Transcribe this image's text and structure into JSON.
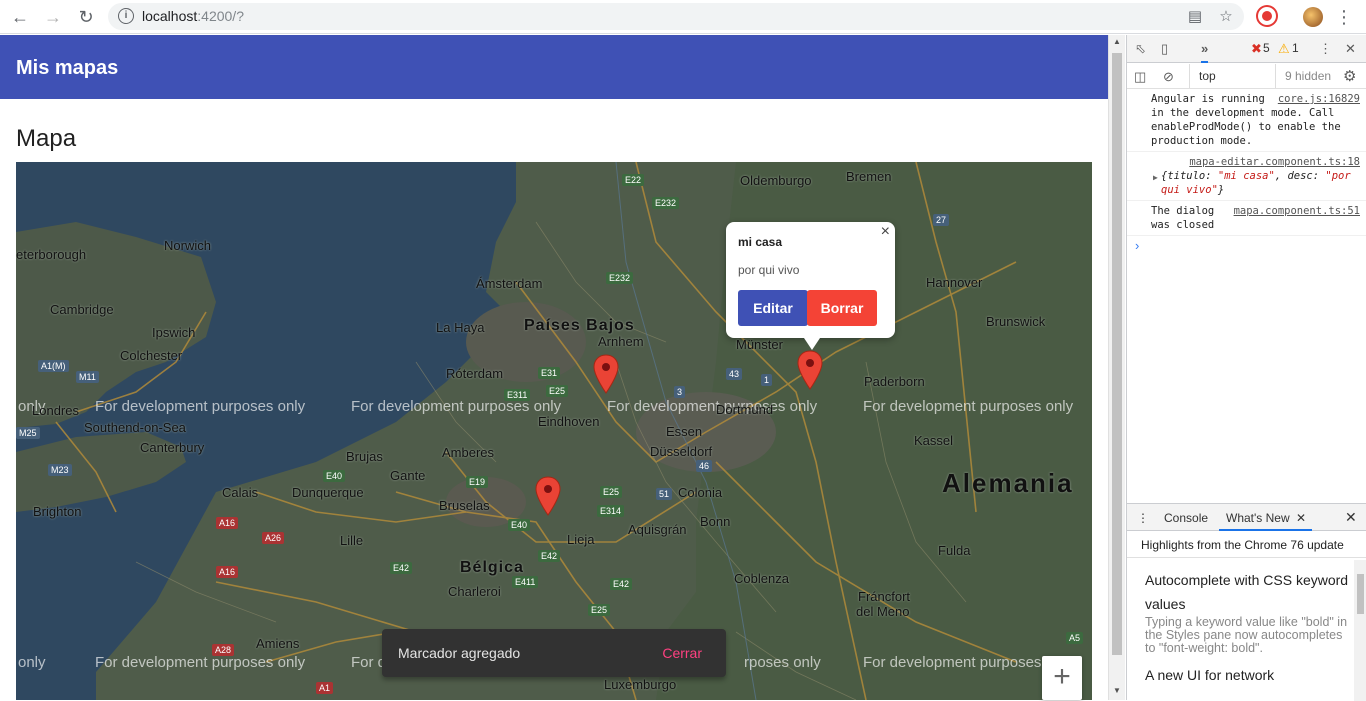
{
  "browser": {
    "url_host": "localhost",
    "url_rest": ":4200/?"
  },
  "app": {
    "toolbar_title": "Mis mapas",
    "page_heading": "Mapa"
  },
  "map": {
    "cities": [
      {
        "name": "Oldemburgo"
      },
      {
        "name": "Bremen"
      },
      {
        "name": "Norwich"
      },
      {
        "name": "eterborough"
      },
      {
        "name": "Ámsterdam"
      },
      {
        "name": "Hannover"
      },
      {
        "name": "Cambridge"
      },
      {
        "name": "Ipswich"
      },
      {
        "name": "La Haya"
      },
      {
        "name": "Arnhem"
      },
      {
        "name": "Brunswick"
      },
      {
        "name": "Colchester"
      },
      {
        "name": "Münster"
      },
      {
        "name": "Róterdam"
      },
      {
        "name": "Paderborn"
      },
      {
        "name": "Londres"
      },
      {
        "name": "Eindhoven"
      },
      {
        "name": "Southend-on-Sea"
      },
      {
        "name": "Essen"
      },
      {
        "name": "Dortmund"
      },
      {
        "name": "Kassel"
      },
      {
        "name": "Canterbury"
      },
      {
        "name": "Brujas"
      },
      {
        "name": "Amberes"
      },
      {
        "name": "Düsseldorf"
      },
      {
        "name": "Gante"
      },
      {
        "name": "Calais"
      },
      {
        "name": "Dunquerque"
      },
      {
        "name": "Colonia"
      },
      {
        "name": "Bruselas"
      },
      {
        "name": "Brighton"
      },
      {
        "name": "Aquisgrán"
      },
      {
        "name": "Bonn"
      },
      {
        "name": "Lille"
      },
      {
        "name": "Lieja"
      },
      {
        "name": "Fulda"
      },
      {
        "name": "Charleroi"
      },
      {
        "name": "Coblenza"
      },
      {
        "name": "Fráncfort"
      },
      {
        "name": "del Meno"
      },
      {
        "name": "Amiens"
      },
      {
        "name": "Luxemburgo"
      }
    ],
    "countries": [
      {
        "name": "Países Bajos"
      },
      {
        "name": "Alemania"
      },
      {
        "name": "Bélgica"
      }
    ],
    "watermark": "For development purposes only",
    "watermark_fragment_only": "only",
    "watermark_fragment_for": "For d",
    "watermark_fragment_end": "rposes only",
    "info_window": {
      "title": "mi casa",
      "description": "por qui vivo",
      "edit_label": "Editar",
      "delete_label": "Borrar",
      "close_glyph": "×"
    },
    "zoom_in_glyph": "+"
  },
  "snackbar": {
    "message": "Marcador agregado",
    "action": "Cerrar"
  },
  "devtools": {
    "error_count": "5",
    "warning_count": "1",
    "context": "top",
    "hidden_count": "9 hidden",
    "logs": [
      {
        "text": "Angular is running in the development mode. Call enableProdMode() to enable the production mode.",
        "source": "core.js:16829"
      },
      {
        "source": "mapa-editar.component.ts:18",
        "object_prefix": "{titulo: ",
        "titulo_value": "\"mi casa\"",
        "object_mid": ", desc: ",
        "desc_value": "\"por qui vivo\"",
        "object_suffix": "}"
      },
      {
        "text": "The dialog was closed",
        "source": "mapa.component.ts:51"
      }
    ],
    "drawer": {
      "tab_console": "Console",
      "tab_whats_new": "What's New",
      "highlights": "Highlights from the Chrome 76 update",
      "item1_title": "Autocomplete with CSS keyword values",
      "item1_body": "Typing a keyword value like \"bold\" in the Styles pane now autocompletes to \"font-weight: bold\".",
      "item2_title": "A new UI for network"
    }
  }
}
